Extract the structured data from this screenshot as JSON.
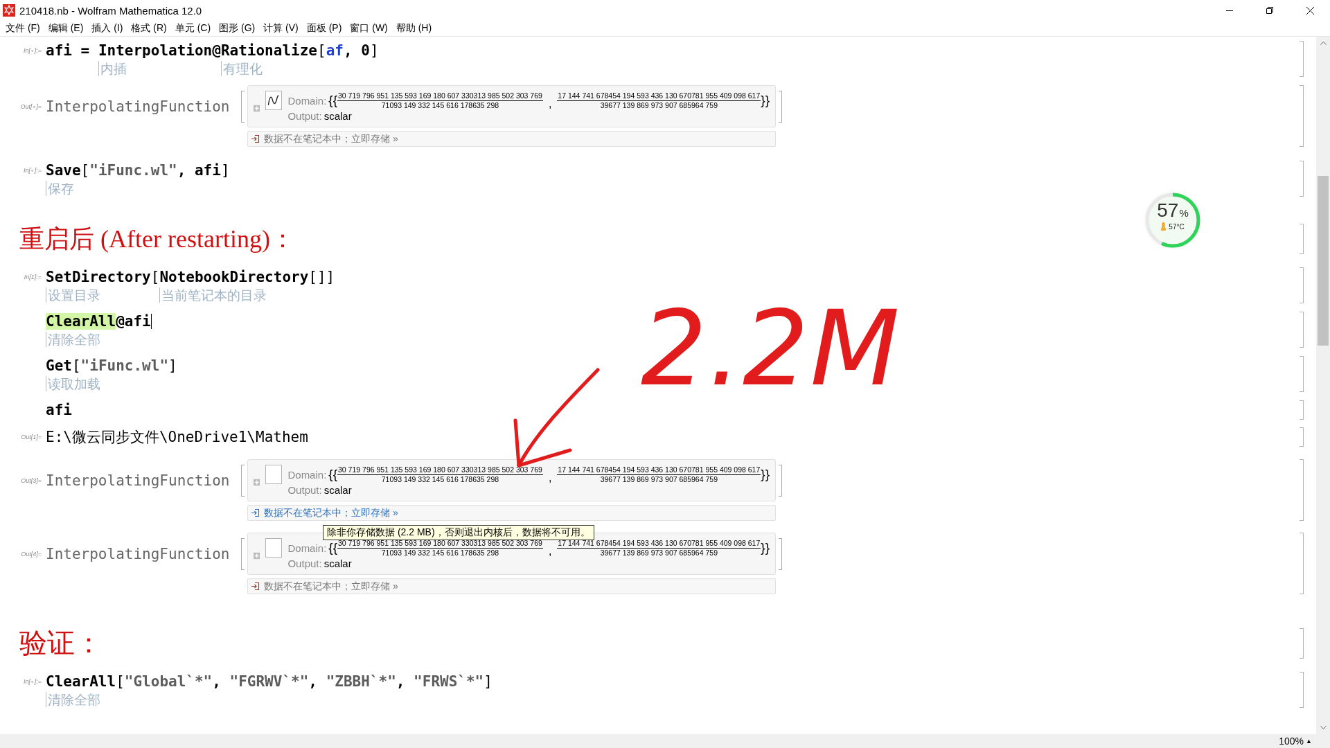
{
  "window": {
    "title": "210418.nb - Wolfram Mathematica 12.0"
  },
  "menu": [
    {
      "label": "文件 (F)"
    },
    {
      "label": "编辑 (E)"
    },
    {
      "label": "插入 (I)"
    },
    {
      "label": "格式 (R)"
    },
    {
      "label": "单元 (C)"
    },
    {
      "label": "图形 (G)"
    },
    {
      "label": "计算 (V)"
    },
    {
      "label": "面板 (P)"
    },
    {
      "label": "窗口 (W)"
    },
    {
      "label": "帮助 (H)"
    }
  ],
  "cells": [
    {
      "kind": "input",
      "label": "In[∘]:=",
      "cursor": false,
      "tokens": [
        {
          "text": "afi",
          "kind": "bold"
        },
        {
          "text": " = ",
          "kind": "bold"
        },
        {
          "text": "Interpolation",
          "kind": "bold",
          "note": "内插"
        },
        {
          "text": "@",
          "kind": "bold"
        },
        {
          "text": "Rationalize",
          "kind": "bold",
          "note": "有理化"
        },
        {
          "text": "[",
          "kind": "plain"
        },
        {
          "text": "af",
          "kind": "undefined"
        },
        {
          "text": ", 0",
          "kind": "bold"
        },
        {
          "text": "]",
          "kind": "plain"
        }
      ]
    },
    {
      "kind": "interpolating",
      "label": "Out[∘]=",
      "head": "InterpolatingFunction",
      "thumbnail": {
        "kind": "plot"
      },
      "domain_label": "Domain:",
      "open": "{{",
      "separator": ",",
      "close": "}}",
      "domain": [
        {
          "numerator": "30 719 796 951 135 593 169 180 607 330313 985 502 303 769",
          "denominator": "71093 149 332 145 616 178635 298"
        },
        {
          "numerator": "17 144 741 678454 194 593 436 130 670781 955 409 098 617",
          "denominator": "39677 139 869 973 907 685964 759"
        }
      ],
      "output_label": "Output:",
      "output": "scalar",
      "storage_link": "数据不在笔记本中；立即存储 »",
      "link_active": false
    },
    {
      "kind": "input",
      "label": "In[∘]:=",
      "cursor": false,
      "tokens": [
        {
          "text": "Save",
          "kind": "bold",
          "note": "保存"
        },
        {
          "text": "[",
          "kind": "plain"
        },
        {
          "text": "\"iFunc.wl\"",
          "kind": "string"
        },
        {
          "text": ", afi",
          "kind": "bold"
        },
        {
          "text": "]",
          "kind": "plain"
        }
      ]
    },
    {
      "kind": "section",
      "text": "重启后 (After restarting)："
    },
    {
      "kind": "input",
      "label": "In[1]:=",
      "cursor": false,
      "tokens": [
        {
          "text": "SetDirectory",
          "kind": "bold",
          "note": "设置目录"
        },
        {
          "text": "[",
          "kind": "plain"
        },
        {
          "text": "NotebookDirectory",
          "kind": "bold",
          "note": "当前笔记本的目录"
        },
        {
          "text": "[]]",
          "kind": "plain"
        }
      ]
    },
    {
      "kind": "input",
      "cursor": true,
      "tokens": [
        {
          "text": "ClearAll",
          "kind": "highlighted",
          "note": "清除全部"
        },
        {
          "text": "@afi",
          "kind": "bold"
        }
      ]
    },
    {
      "kind": "input",
      "cursor": false,
      "tokens": [
        {
          "text": "Get",
          "kind": "bold",
          "note": "读取加载"
        },
        {
          "text": "[",
          "kind": "plain"
        },
        {
          "text": "\"iFunc.wl\"",
          "kind": "string"
        },
        {
          "text": "]",
          "kind": "plain"
        }
      ]
    },
    {
      "kind": "input",
      "cursor": false,
      "tokens": [
        {
          "text": "afi",
          "kind": "bold"
        }
      ]
    },
    {
      "kind": "output_text",
      "label": "Out[1]=",
      "text": "E:\\微云同步文件\\OneDrive1\\Mathem"
    },
    {
      "kind": "interpolating",
      "label": "Out[3]=",
      "head": "InterpolatingFunction",
      "thumbnail": {
        "kind": "blank"
      },
      "domain_label": "Domain:",
      "open": "{{",
      "separator": ",",
      "close": "}}",
      "domain": [
        {
          "numerator": "30 719 796 951 135 593 169 180 607 330313 985 502 303 769",
          "denominator": "71093 149 332 145 616 178635 298"
        },
        {
          "numerator": "17 144 741 678454 194 593 436 130 670781 955 409 098 617",
          "denominator": "39677 139 869 973 907 685964 759"
        }
      ],
      "output_label": "Output:",
      "output": "scalar",
      "storage_link": "数据不在笔记本中；立即存储 »",
      "link_active": true,
      "tooltip": "除非你存储数据 (2.2 MB)，否则退出内核后，数据将不可用。"
    },
    {
      "kind": "interpolating",
      "label": "Out[4]=",
      "head": "InterpolatingFunction",
      "thumbnail": {
        "kind": "blank"
      },
      "domain_label": "Domain:",
      "open": "{{",
      "separator": ",",
      "close": "}}",
      "domain": [
        {
          "numerator": "30 719 796 951 135 593 169 180 607 330313 985 502 303 769",
          "denominator": "71093 149 332 145 616 178635 298"
        },
        {
          "numerator": "17 144 741 678454 194 593 436 130 670781 955 409 098 617",
          "denominator": "39677 139 869 973 907 685964 759"
        }
      ],
      "output_label": "Output:",
      "output": "scalar",
      "storage_link": "数据不在笔记本中；立即存储 »",
      "link_active": false
    },
    {
      "kind": "section",
      "text": "验证："
    },
    {
      "kind": "input",
      "label": "In[∘]:=",
      "cursor": false,
      "tokens": [
        {
          "text": "ClearAll",
          "kind": "bold",
          "note": "清除全部"
        },
        {
          "text": "[",
          "kind": "plain"
        },
        {
          "text": "\"Global`*\"",
          "kind": "string"
        },
        {
          "text": ", ",
          "kind": "bold"
        },
        {
          "text": "\"FGRWV`*\"",
          "kind": "string"
        },
        {
          "text": ", ",
          "kind": "bold"
        },
        {
          "text": "\"ZBBH`*\"",
          "kind": "string"
        },
        {
          "text": ", ",
          "kind": "bold"
        },
        {
          "text": "\"FRWS`*\"",
          "kind": "string"
        },
        {
          "text": "]",
          "kind": "plain"
        }
      ]
    }
  ],
  "handwriting": {
    "text": "2.2M"
  },
  "gauge": {
    "percent": "57",
    "unit": "%",
    "temperature": "57°C",
    "level": 0.57
  },
  "status_bar": {
    "zoom": "100%",
    "zoom_arrow": "▲"
  }
}
